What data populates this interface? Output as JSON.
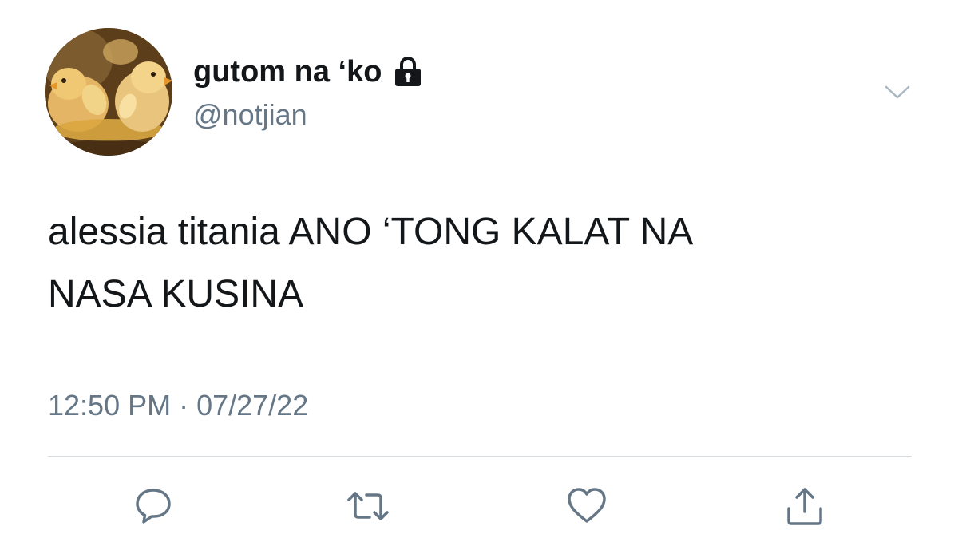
{
  "user": {
    "display_name": "gutom na ‘ko",
    "handle": "@notjian",
    "locked": true
  },
  "tweet": {
    "text_lines": [
      "alessia titania ANO ‘TONG KALAT NA",
      "NASA KUSINA"
    ],
    "timestamp": "12:50 PM · 07/27/22"
  },
  "actions": [
    {
      "name": "reply",
      "icon": "speech-bubble-icon"
    },
    {
      "name": "retweet",
      "icon": "retweet-arrows-icon"
    },
    {
      "name": "like",
      "icon": "heart-icon"
    },
    {
      "name": "share",
      "icon": "share-upload-icon"
    }
  ],
  "menu": {
    "icon": "chevron-down-icon"
  },
  "colors": {
    "text": "#14171a",
    "secondary": "#657786",
    "divider": "#d8dde2",
    "icon": "#657786"
  }
}
